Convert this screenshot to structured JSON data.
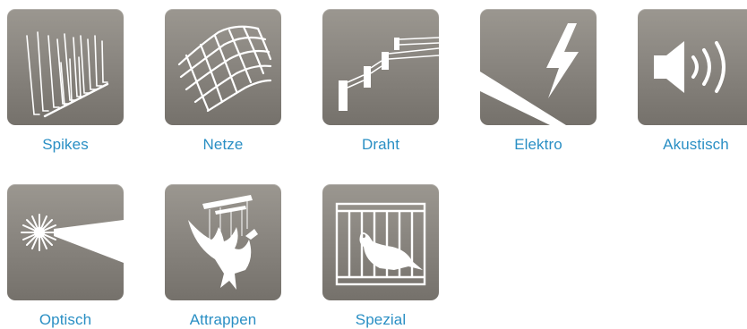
{
  "categories": [
    {
      "label": "Spikes",
      "icon": "spikes-icon"
    },
    {
      "label": "Netze",
      "icon": "net-icon"
    },
    {
      "label": "Draht",
      "icon": "wire-icon"
    },
    {
      "label": "Elektro",
      "icon": "lightning-icon"
    },
    {
      "label": "Akustisch",
      "icon": "speaker-icon"
    },
    {
      "label": "Optisch",
      "icon": "laser-icon"
    },
    {
      "label": "Attrappen",
      "icon": "eagle-decoy-icon"
    },
    {
      "label": "Spezial",
      "icon": "pigeon-cage-icon"
    }
  ],
  "colors": {
    "tile": "#8a8680",
    "label": "#2a8fc4",
    "icon": "#ffffff"
  }
}
